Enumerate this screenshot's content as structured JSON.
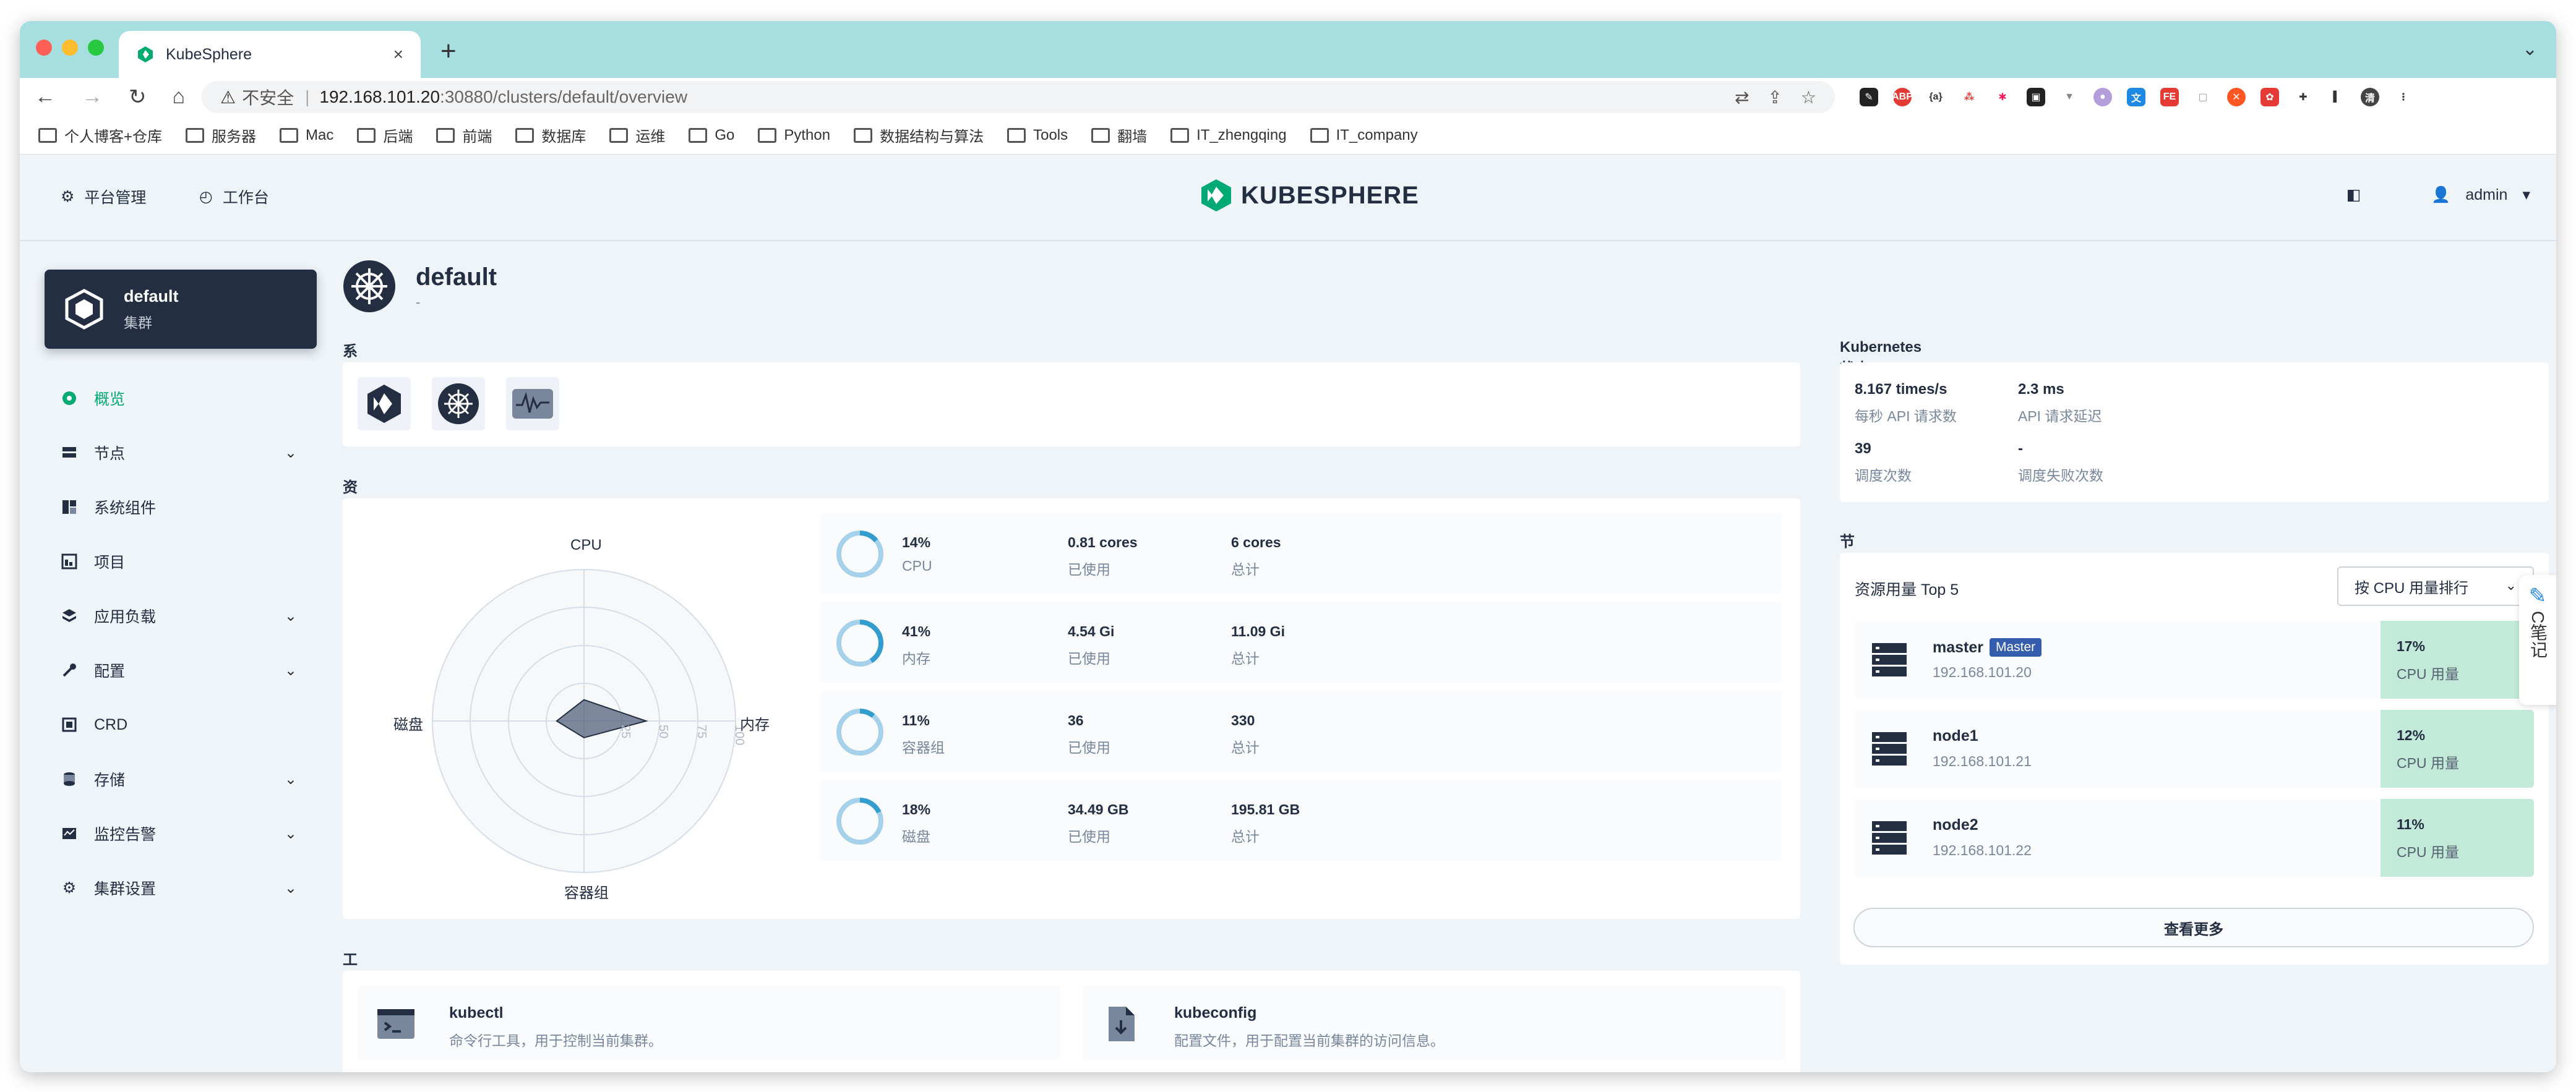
{
  "browser": {
    "tab_title": "KubeSphere",
    "url_insecure": "不安全",
    "url_host": "192.168.101.20",
    "url_path": ":30880/clusters/default/overview",
    "bookmarks": [
      "个人博客+仓库",
      "服务器",
      "Mac",
      "后端",
      "前端",
      "数据库",
      "运维",
      "Go",
      "Python",
      "数据结构与算法",
      "Tools",
      "翻墙",
      "IT_zhengqing",
      "IT_company"
    ]
  },
  "topnav": {
    "platform": "平台管理",
    "workbench": "工作台",
    "logo_text": "KUBESPHERE",
    "user": "admin"
  },
  "cluster_card": {
    "name": "default",
    "type": "集群"
  },
  "sidebar": {
    "items": [
      {
        "label": "概览",
        "icon": "overview-icon"
      },
      {
        "label": "节点",
        "icon": "nodes-icon"
      },
      {
        "label": "系统组件",
        "icon": "components-icon"
      },
      {
        "label": "项目",
        "icon": "projects-icon"
      },
      {
        "label": "应用负载",
        "icon": "workloads-icon"
      },
      {
        "label": "配置",
        "icon": "config-icon"
      },
      {
        "label": "CRD",
        "icon": "crd-icon"
      },
      {
        "label": "存储",
        "icon": "storage-icon"
      },
      {
        "label": "监控告警",
        "icon": "monitoring-icon"
      },
      {
        "label": "集群设置",
        "icon": "settings-icon"
      }
    ]
  },
  "header": {
    "title": "default",
    "desc": "-"
  },
  "sections": {
    "components": "系统组件",
    "resources": "资源用量",
    "tools": "工具",
    "k8s": "Kubernetes 状态",
    "nodes": "节点"
  },
  "radar": {
    "labels": {
      "top": "CPU",
      "right": "内存",
      "bottom": "容器组",
      "left": "磁盘"
    },
    "ticks": [
      "25",
      "50",
      "75",
      "100"
    ]
  },
  "usage": [
    {
      "percent": "14%",
      "name": "CPU",
      "used": "0.81 cores",
      "used_label": "已使用",
      "total": "6 cores",
      "total_label": "总计",
      "ratio": 0.14
    },
    {
      "percent": "41%",
      "name": "内存",
      "used": "4.54 Gi",
      "used_label": "已使用",
      "total": "11.09 Gi",
      "total_label": "总计",
      "ratio": 0.41
    },
    {
      "percent": "11%",
      "name": "容器组",
      "used": "36",
      "used_label": "已使用",
      "total": "330",
      "total_label": "总计",
      "ratio": 0.11
    },
    {
      "percent": "18%",
      "name": "磁盘",
      "used": "34.49 GB",
      "used_label": "已使用",
      "total": "195.81 GB",
      "total_label": "总计",
      "ratio": 0.18
    }
  ],
  "k8s_status": [
    {
      "value": "8.167 times/s",
      "label": "每秒 API 请求数"
    },
    {
      "value": "2.3 ms",
      "label": "API 请求延迟"
    },
    {
      "value": "39",
      "label": "调度次数"
    },
    {
      "value": "-",
      "label": "调度失败次数"
    }
  ],
  "nodes_panel": {
    "title": "资源用量 Top 5",
    "sort_select": "按 CPU 用量排行",
    "more": "查看更多",
    "nodes": [
      {
        "name": "master",
        "badge": "Master",
        "ip": "192.168.101.20",
        "cpu": "17%",
        "cpu_label": "CPU 用量"
      },
      {
        "name": "node1",
        "badge": "",
        "ip": "192.168.101.21",
        "cpu": "12%",
        "cpu_label": "CPU 用量"
      },
      {
        "name": "node2",
        "badge": "",
        "ip": "192.168.101.22",
        "cpu": "11%",
        "cpu_label": "CPU 用量"
      }
    ]
  },
  "tools": [
    {
      "name": "kubectl",
      "desc": "命令行工具，用于控制当前集群。"
    },
    {
      "name": "kubeconfig",
      "desc": "配置文件，用于配置当前集群的访问信息。"
    }
  ],
  "float_note": {
    "label": "C笔记"
  },
  "colors": {
    "accent": "#00aa72",
    "dark": "#242e42",
    "blue": "#329dce",
    "cpu_bg": "#c3ead9"
  }
}
